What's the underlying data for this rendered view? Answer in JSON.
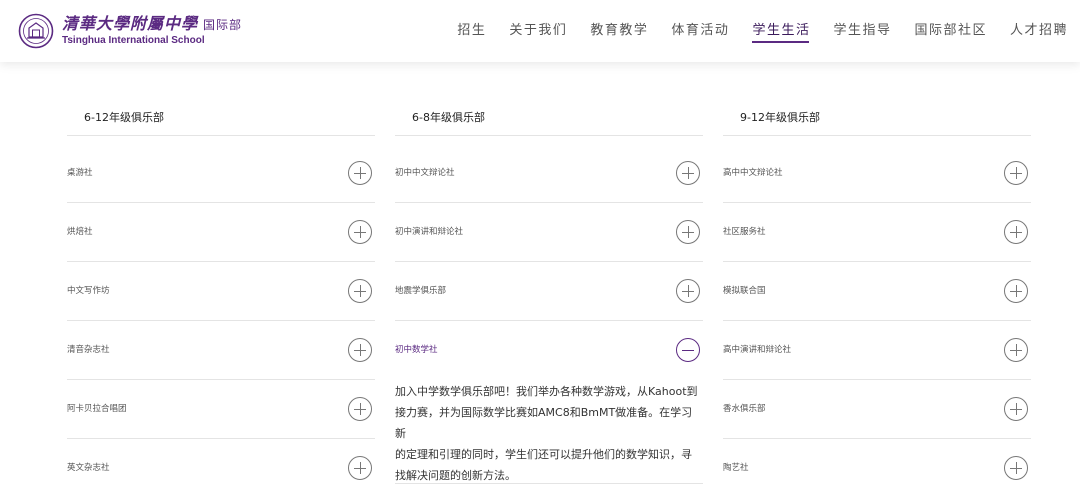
{
  "header": {
    "logo_cn": "清華大學附屬中學",
    "logo_cn_sub": "国际部",
    "logo_en": "Tsinghua International School",
    "nav": [
      {
        "label": "招生",
        "active": false
      },
      {
        "label": "关于我们",
        "active": false
      },
      {
        "label": "教育教学",
        "active": false
      },
      {
        "label": "体育活动",
        "active": false
      },
      {
        "label": "学生生活",
        "active": true
      },
      {
        "label": "学生指导",
        "active": false
      },
      {
        "label": "国际部社区",
        "active": false
      },
      {
        "label": "人才招聘",
        "active": false
      }
    ]
  },
  "columns": [
    {
      "title": "6-12年级俱乐部",
      "items": [
        "桌游社",
        "烘焙社",
        "中文写作坊",
        "清音杂志社",
        "阿卡贝拉合唱团",
        "英文杂志社"
      ]
    },
    {
      "title": "6-8年级俱乐部",
      "items": [
        "初中中文辩论社",
        "初中演讲和辩论社",
        "地震学俱乐部",
        "初中数学社"
      ],
      "open_index": 3,
      "open_description_lines": [
        "加入中学数学俱乐部吧！我们举办各种数学游戏，从Kahoot到",
        "接力赛，并为国际数学比赛如AMC8和BmMT做准备。在学习新",
        "的定理和引理的同时，学生们还可以提升他们的数学知识，寻",
        "找解决问题的创新方法。"
      ]
    },
    {
      "title": "9-12年级俱乐部",
      "items": [
        "高中中文辩论社",
        "社区服务社",
        "模拟联合国",
        "高中演讲和辩论社",
        "香水俱乐部",
        "陶艺社"
      ]
    }
  ],
  "colors": {
    "accent": "#5b2a82",
    "divider": "#e4e4e4"
  },
  "icons": {
    "logo": "school-seal-icon",
    "collapsed": "plus-circle-icon",
    "expanded": "minus-circle-icon"
  }
}
